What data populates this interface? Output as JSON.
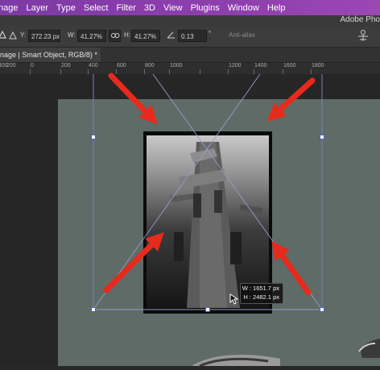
{
  "menubar": {
    "items": [
      "nage",
      "Layer",
      "Type",
      "Select",
      "Filter",
      "3D",
      "View",
      "Plugins",
      "Window",
      "Help"
    ]
  },
  "app": {
    "title": "Adobe Pho"
  },
  "options": {
    "y_label": "Y:",
    "y_value": "272.23 px",
    "w_label": "W:",
    "w_value": "41.27%",
    "h_label": "H:",
    "h_value": "41.27%",
    "angle_value": "0.13",
    "degree_symbol": "°",
    "antialias_label": "Anti-alias"
  },
  "document_tab": {
    "title": "nage | Smart Object, RGB/8) *"
  },
  "ruler": {
    "ticks": [
      "400",
      "200",
      "0",
      "200",
      "400",
      "600",
      "800",
      "1000",
      "1200",
      "1400",
      "1600",
      "1800"
    ]
  },
  "transform_tooltip": {
    "width": "W : 1651.7 px",
    "height": "H : 2482.1 px"
  },
  "colors": {
    "arrow": "#e82a1c",
    "bounding_box": "#4a5fc6",
    "menubar": "#8e3fae",
    "document_bg": "#5f6b66"
  },
  "icons": [
    "triangle-icon",
    "link-icon",
    "angle-icon",
    "warp-icon",
    "cursor-icon"
  ]
}
